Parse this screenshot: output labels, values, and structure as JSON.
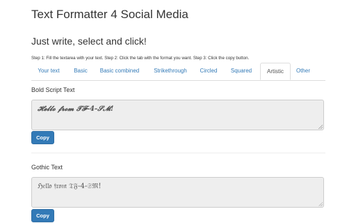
{
  "app": {
    "title": "Text Formatter 4 Social Media"
  },
  "intro": {
    "heading": "Just write, select and click!",
    "instructions": "Step 1: Fill the textarea with your text. Step 2: Click the tab with the format you want. Step 3: Click the copy button."
  },
  "tabs": [
    {
      "label": "Your text",
      "active": false
    },
    {
      "label": "Basic",
      "active": false
    },
    {
      "label": "Basic combined",
      "active": false
    },
    {
      "label": "Strikethrough",
      "active": false
    },
    {
      "label": "Circled",
      "active": false
    },
    {
      "label": "Squared",
      "active": false
    },
    {
      "label": "Artistic",
      "active": true
    },
    {
      "label": "Other",
      "active": false
    }
  ],
  "sections": [
    {
      "label": "Bold Script Text",
      "text": "𝓗𝓮𝓵𝓵𝓸 𝓯𝓻𝓸𝓶 𝓣𝓕-4-𝓢𝓜!",
      "copy_label": "Copy"
    },
    {
      "label": "Gothic Text",
      "text": "ℌ𝔢𝔩𝔩𝔬 𝔣𝔯𝔬𝔪 𝔗𝔉-4-𝔖𝔐!",
      "copy_label": "Copy"
    }
  ],
  "colors": {
    "link": "#337ab7",
    "button": "#337ab7",
    "textarea_bg": "#eeeeee"
  }
}
